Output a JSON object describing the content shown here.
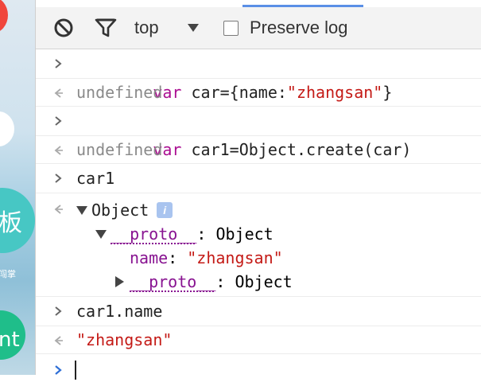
{
  "background_page": {
    "char_board": "板",
    "char_small": "闯掌",
    "text_nt": "nt"
  },
  "toolbar": {
    "context": "top",
    "preserve_log_label": "Preserve log"
  },
  "console": {
    "entries": [
      {
        "type": "input",
        "keyword": "var",
        "rest_a": " car={name:",
        "string": "\"zhangsan\"",
        "rest_b": "}"
      },
      {
        "type": "output",
        "text": "undefined"
      },
      {
        "type": "input",
        "keyword": "var",
        "rest_a": " car1=Object.create(car)"
      },
      {
        "type": "output",
        "text": "undefined"
      },
      {
        "type": "input",
        "text": "car1"
      },
      {
        "type": "output_object",
        "label": "Object",
        "info": "i",
        "tree": {
          "proto_label": "__proto__",
          "proto_value": ": Object",
          "prop_key": "name",
          "prop_sep": ": ",
          "prop_value": "\"zhangsan\"",
          "inner_proto_label": "__proto__",
          "inner_proto_value": ": Object"
        }
      },
      {
        "type": "input",
        "text": "car1.name"
      },
      {
        "type": "output",
        "text": "\"zhangsan\""
      }
    ]
  },
  "colors": {
    "keyword": "#aa0d91",
    "string": "#c41a16",
    "property": "#881391",
    "muted": "#8a8a8a",
    "prompt_blue": "#2f6fd6"
  }
}
